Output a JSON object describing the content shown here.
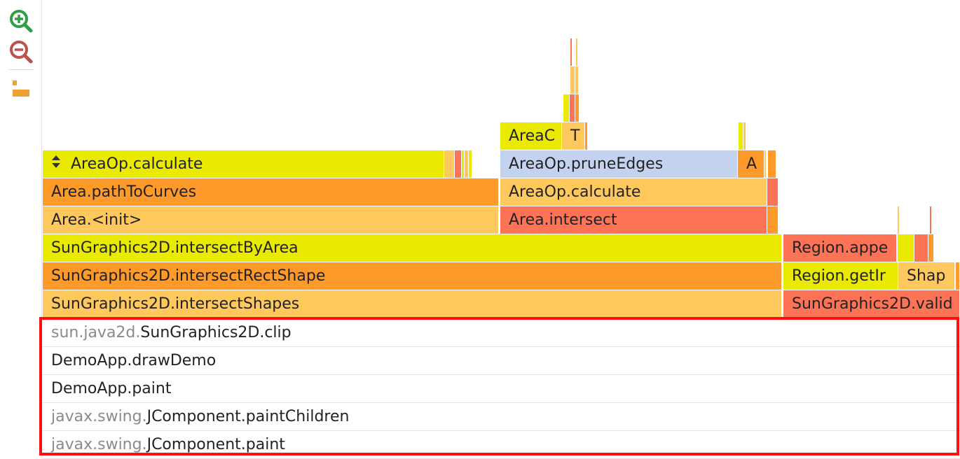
{
  "toolbar": {
    "zoom_in": "zoom-in-icon",
    "zoom_out": "zoom-out-icon",
    "layout": "flame-layout-icon"
  },
  "colors": {
    "yellow": "#eaea00",
    "orange": "#fd9a2a",
    "light_orange": "#fec85d",
    "red": "#fd7355",
    "blue": "#c3d2ee",
    "highlight": "#ff1010"
  },
  "frames": {
    "row6": {
      "area_op_calculate_a": "AreaOp.calculate",
      "area_c": "AreaC",
      "t": "T",
      "area_op_prune_edges": "AreaOp.pruneEdges",
      "a": "A"
    },
    "row5": {
      "area_path_to_curves": "Area.pathToCurves",
      "area_op_calculate_b": "AreaOp.calculate"
    },
    "row4": {
      "area_init": "Area.<init>",
      "area_intersect": "Area.intersect"
    },
    "row3": {
      "intersect_by_area": "SunGraphics2D.intersectByArea",
      "region_appe": "Region.appe"
    },
    "row2": {
      "intersect_rect_shape": "SunGraphics2D.intersectRectShape",
      "region_get": "Region.getIr",
      "shap": "Shap"
    },
    "row1": {
      "intersect_shapes": "SunGraphics2D.intersectShapes",
      "validate": "SunGraphics2D.valid"
    }
  },
  "stack": [
    {
      "pkg": "sun.java2d.",
      "name": "SunGraphics2D.clip"
    },
    {
      "pkg": "",
      "name": "DemoApp.drawDemo"
    },
    {
      "pkg": "",
      "name": "DemoApp.paint"
    },
    {
      "pkg": "javax.swing.",
      "name": "JComponent.paintChildren"
    },
    {
      "pkg": "javax.swing.",
      "name": "JComponent.paint"
    }
  ]
}
